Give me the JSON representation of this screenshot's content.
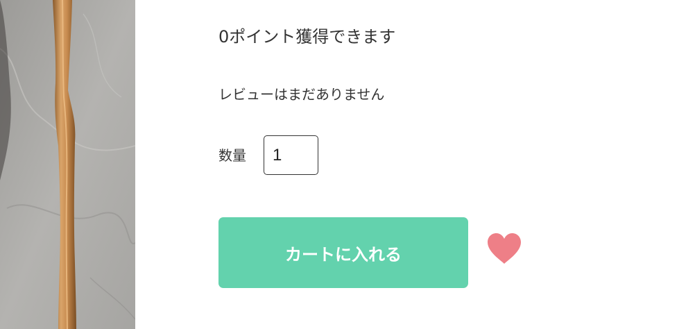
{
  "product": {
    "points_text": "0ポイント獲得できます",
    "review_text": "レビューはまだありません"
  },
  "quantity": {
    "label": "数量",
    "value": "1"
  },
  "actions": {
    "add_to_cart_label": "カートに入れる",
    "favorite_icon": "heart-icon"
  },
  "colors": {
    "cart_button": "#63d2ad",
    "heart": "#ee7f87"
  }
}
